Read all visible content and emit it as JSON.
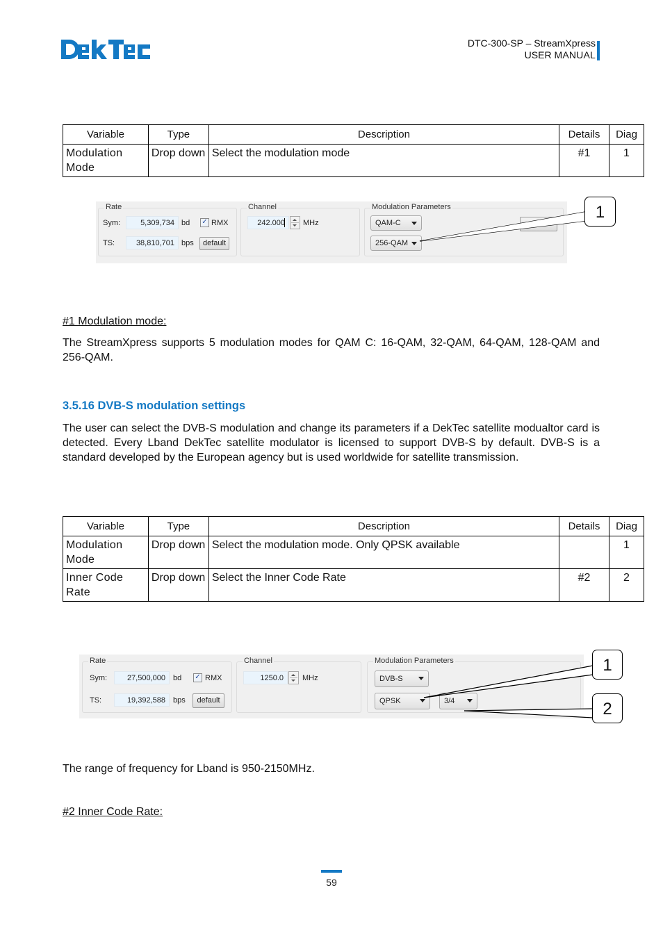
{
  "header": {
    "logo_text": "DekTec",
    "product": "DTC-300-SP – StreamXpress",
    "manual_prefix": "USER ",
    "manual_label": "MANUAL",
    "accent_color": "#1479c4"
  },
  "table1": {
    "headers": [
      "Variable",
      "Type",
      "Description",
      "Details",
      "Diag"
    ],
    "rows": [
      {
        "variable": "Modulation Mode",
        "type": "Drop down",
        "description": "Select the modulation mode",
        "details": "#1",
        "diag": "1"
      }
    ]
  },
  "screenshot1": {
    "rate_group": "Rate",
    "sym_label": "Sym:",
    "sym_value": "5,309,734",
    "sym_unit": "bd",
    "rmx_checked": true,
    "rmx_label": "RMX",
    "ts_label": "TS:",
    "ts_value": "38,810,701",
    "ts_unit": "bps",
    "default_button": "default",
    "channel_group": "Channel",
    "channel_value": "242.000",
    "channel_unit": "MHz",
    "modulation_group": "Modulation Parameters",
    "standard_dropdown": "QAM-C",
    "constellation_dropdown": "256-QAM",
    "obscured_button": "",
    "callouts": [
      "1"
    ]
  },
  "section_details1": {
    "heading": "#1 Modulation mode:",
    "paragraph": "The StreamXpress supports 5 modulation modes for QAM C: 16-QAM, 32-QAM, 64-QAM, 128-QAM and 256-QAM."
  },
  "section_dvbs": {
    "heading": "3.5.16 DVB-S modulation settings",
    "paragraph": "The user can select the DVB-S modulation and change its parameters if a DekTec satellite modualtor card is detected. Every Lband DekTec satellite modulator is licensed to support DVB-S by default. DVB-S is a standard developed by the European agency but is used worldwide for satellite transmission."
  },
  "table2": {
    "headers": [
      "Variable",
      "Type",
      "Description",
      "Details",
      "Diag"
    ],
    "rows": [
      {
        "variable": "Modulation Mode",
        "type": "Drop down",
        "description": "Select the modulation mode. Only QPSK available",
        "details": "",
        "diag": "1"
      },
      {
        "variable": "Inner Code Rate",
        "type": "Drop down",
        "description": "Select the Inner Code Rate",
        "details": "#2",
        "diag": "2"
      }
    ]
  },
  "screenshot2": {
    "rate_group": "Rate",
    "sym_label": "Sym:",
    "sym_value": "27,500,000",
    "sym_unit": "bd",
    "rmx_checked": true,
    "rmx_label": "RMX",
    "ts_label": "TS:",
    "ts_value": "19,392,588",
    "ts_unit": "bps",
    "default_button": "default",
    "channel_group": "Channel",
    "channel_value": "1250.0",
    "channel_unit": "MHz",
    "modulation_group": "Modulation Parameters",
    "standard_dropdown": "DVB-S",
    "constellation_dropdown": "QPSK",
    "code_rate_dropdown": "3/4",
    "callouts": [
      "1",
      "2"
    ]
  },
  "lband_note": "The range of frequency for Lband is 950-2150MHz.",
  "section_details2": {
    "heading": "#2 Inner Code Rate:"
  },
  "footer": {
    "page_number": "59"
  }
}
